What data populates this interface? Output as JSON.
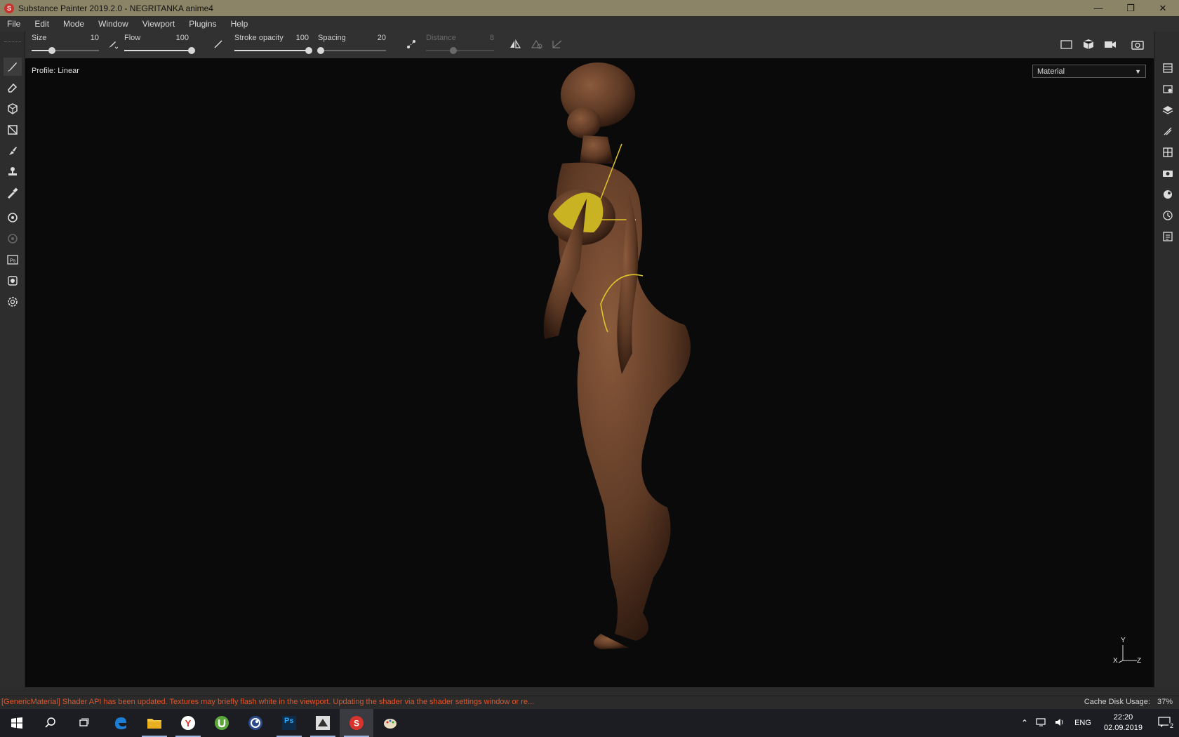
{
  "window": {
    "title": "Substance Painter 2019.2.0 - NEGRITANKA anime4",
    "app_icon_letter": "S",
    "minimize": "—",
    "restore": "❐",
    "close": "✕"
  },
  "menu": [
    "File",
    "Edit",
    "Mode",
    "Window",
    "Viewport",
    "Plugins",
    "Help"
  ],
  "toolbar": {
    "size": {
      "label": "Size",
      "value": "10",
      "fraction": 0.3
    },
    "flow": {
      "label": "Flow",
      "value": "100",
      "fraction": 1.0
    },
    "stroke_opacity": {
      "label": "Stroke opacity",
      "value": "100",
      "fraction": 1.0
    },
    "spacing": {
      "label": "Spacing",
      "value": "20",
      "fraction": 0.04
    },
    "distance": {
      "label": "Distance",
      "value": "8",
      "fraction": 0.4
    }
  },
  "left_tools": [
    "paint-brush-icon",
    "eraser-icon",
    "projection-icon",
    "polygon-fill-icon",
    "smudge-icon",
    "clone-stamp-icon",
    "color-picker-icon",
    "bake-icon",
    "bake-disabled-icon",
    "photoshop-export-icon",
    "iray-render-icon",
    "settings-icon"
  ],
  "right_tools": [
    "texture-set-list-icon",
    "texture-set-settings-icon",
    "layers-icon",
    "properties-icon",
    "display-settings-icon",
    "viewer-settings-icon",
    "shelf-icon",
    "history-icon",
    "log-icon"
  ],
  "viewport": {
    "profile_label": "Profile: Linear",
    "channel_select": "Material",
    "axis": {
      "y": "Y",
      "x": "X",
      "z": "Z"
    }
  },
  "status": {
    "message": "[GenericMaterial] Shader API has been updated. Textures may briefly flash white in the viewport. Updating the shader via the shader settings window or re...",
    "cache_label": "Cache Disk Usage:",
    "cache_value": "37%"
  },
  "taskbar": {
    "apps": [
      "windows-start-icon",
      "search-icon",
      "task-view-icon",
      "edge-icon",
      "file-explorer-icon",
      "yandex-browser-icon",
      "utorrent-icon",
      "cinema4d-icon",
      "photoshop-icon",
      "zbrush-icon",
      "substance-painter-icon",
      "paint-icon"
    ],
    "ps_label": "Ps",
    "language": "ENG",
    "time": "22:20",
    "date": "02.09.2019",
    "notifications": "2"
  },
  "colors": {
    "titlebar": "#8c8466",
    "status_message": "#e0552a",
    "viewport_bg": "#0b0a0a"
  }
}
